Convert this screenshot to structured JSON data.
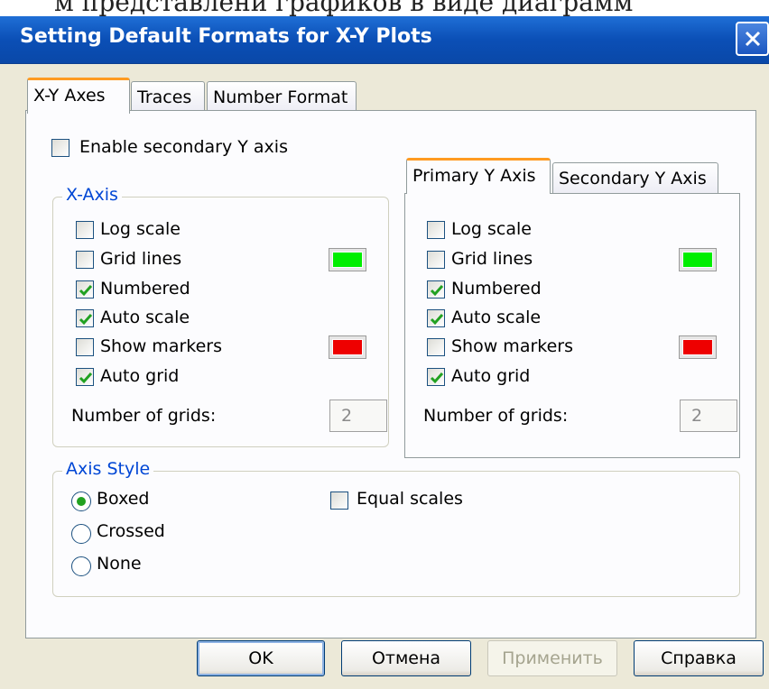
{
  "window": {
    "title": "Setting Default Formats for X-Y Plots"
  },
  "tabs": [
    {
      "label": "X-Y Axes",
      "active": true
    },
    {
      "label": "Traces",
      "active": false
    },
    {
      "label": "Number Format",
      "active": false
    }
  ],
  "enable_secondary": {
    "label": "Enable secondary Y axis",
    "checked": false
  },
  "x_axis": {
    "legend": "X-Axis",
    "options": [
      {
        "label": "Log scale",
        "checked": false
      },
      {
        "label": "Grid lines",
        "checked": false
      },
      {
        "label": "Numbered",
        "checked": true
      },
      {
        "label": "Auto scale",
        "checked": true
      },
      {
        "label": "Show markers",
        "checked": false
      },
      {
        "label": "Auto grid",
        "checked": true
      }
    ],
    "grid_color": "#00ee00",
    "marker_color": "#ee0000",
    "num_grids_label": "Number of grids:",
    "num_grids_value": "2"
  },
  "y_tabs": [
    {
      "label": "Primary Y Axis",
      "active": true
    },
    {
      "label": "Secondary Y Axis",
      "active": false
    }
  ],
  "y_axis": {
    "options": [
      {
        "label": "Log scale",
        "checked": false
      },
      {
        "label": "Grid lines",
        "checked": false
      },
      {
        "label": "Numbered",
        "checked": true
      },
      {
        "label": "Auto scale",
        "checked": true
      },
      {
        "label": "Show markers",
        "checked": false
      },
      {
        "label": "Auto grid",
        "checked": true
      }
    ],
    "grid_color": "#00ee00",
    "marker_color": "#ee0000",
    "num_grids_label": "Number of grids:",
    "num_grids_value": "2"
  },
  "axis_style": {
    "legend": "Axis Style",
    "radios": [
      {
        "label": "Boxed",
        "selected": true
      },
      {
        "label": "Crossed",
        "selected": false
      },
      {
        "label": "None",
        "selected": false
      }
    ],
    "equal_scales": {
      "label": "Equal scales",
      "checked": false
    }
  },
  "buttons": {
    "ok": "OK",
    "cancel": "Отмена",
    "apply": "Применить",
    "help": "Справка"
  },
  "top_fragment": "м представлени графиков в виде диаграмм"
}
